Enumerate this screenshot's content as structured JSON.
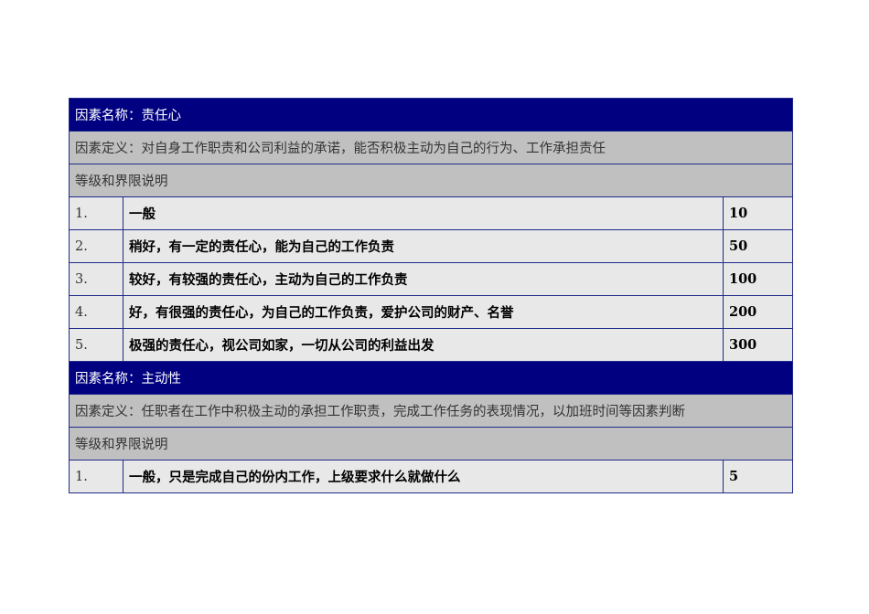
{
  "factors": [
    {
      "name": "因素名称：责任心",
      "definition": "因素定义：对自身工作职责和公司利益的承诺，能否积极主动为自己的行为、工作承担责任",
      "scope_label": "等级和界限说明",
      "levels": [
        {
          "num": "1.",
          "desc": "一般",
          "score": "10"
        },
        {
          "num": "2.",
          "desc": "稍好，有一定的责任心，能为自己的工作负责",
          "score": "50"
        },
        {
          "num": "3.",
          "desc": "较好，有较强的责任心，主动为自己的工作负责",
          "score": "100"
        },
        {
          "num": "4.",
          "desc": "好，有很强的责任心，为自己的工作负责，爱护公司的财产、名誉",
          "score": "200"
        },
        {
          "num": "5.",
          "desc": "极强的责任心，视公司如家，一切从公司的利益出发",
          "score": "300"
        }
      ]
    },
    {
      "name": "因素名称：主动性",
      "definition": "因素定义：任职者在工作中积极主动的承担工作职责，完成工作任务的表现情况，以加班时间等因素判断",
      "scope_label": "等级和界限说明",
      "levels": [
        {
          "num": "1.",
          "desc": "一般，只是完成自己的份内工作，上级要求什么就做什么",
          "score": "5"
        }
      ]
    }
  ]
}
